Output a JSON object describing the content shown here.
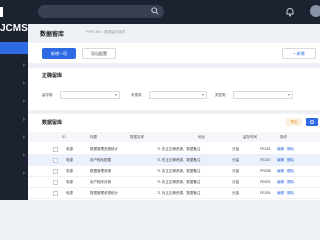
{
  "app": {
    "logo": "JCMS"
  },
  "colors": {
    "sidebar": "#1d2230",
    "accent": "#2d6ae3",
    "background": "#eef1f6",
    "export": "#f6a23a"
  },
  "topbar": {
    "search_icon": "search-icon",
    "icons": [
      "bell-icon",
      "user-icon"
    ]
  },
  "page": {
    "title": "数据留库",
    "breadcrumb": "PHPCMS  ›  数据留存情况"
  },
  "toolbar": {
    "btn_primary": "新增一项",
    "btn_secondary": "导出配置",
    "btn_right": "+ 新增"
  },
  "filter": {
    "title": "正确留库",
    "fields": [
      {
        "label": "留存数:",
        "value": ""
      },
      {
        "label": "来源类:",
        "value": ""
      },
      {
        "label": "类型类:",
        "value": ""
      }
    ]
  },
  "table": {
    "title": "数据留库",
    "export_label": "导出",
    "columns": [
      "ID",
      "标题",
      "数据名称",
      "地址",
      "留存时间",
      "操作"
    ],
    "rows": [
      {
        "type": "电源",
        "name": "数据管理资源统计",
        "desc": "TL 负正正确资源，数据备注",
        "status": "分量",
        "code": "FE125",
        "actions": [
          "编辑",
          "删除"
        ]
      },
      {
        "type": "电源",
        "name": "用户程序配置",
        "desc": "TL 负正正确资源，数据备注",
        "status": "分量",
        "code": "FE220",
        "actions": [
          "编辑",
          "删除"
        ]
      },
      {
        "type": "电源",
        "name": "数据管理资源",
        "desc": "TL 负正正确资源，数据备注",
        "status": "分量",
        "code": "PR258",
        "actions": [
          "编辑",
          "删除"
        ]
      },
      {
        "type": "电源",
        "name": "用户程序存储",
        "desc": "TL 负正正确资源，数据备注",
        "status": "分量",
        "code": "FE525",
        "actions": [
          "编辑",
          "删除"
        ]
      },
      {
        "type": "电源",
        "name": "数据管理资源统计",
        "desc": "TL 负正正确资源，数据备注",
        "status": "分量",
        "code": "FE205",
        "actions": [
          "编辑",
          "删除"
        ]
      }
    ]
  }
}
